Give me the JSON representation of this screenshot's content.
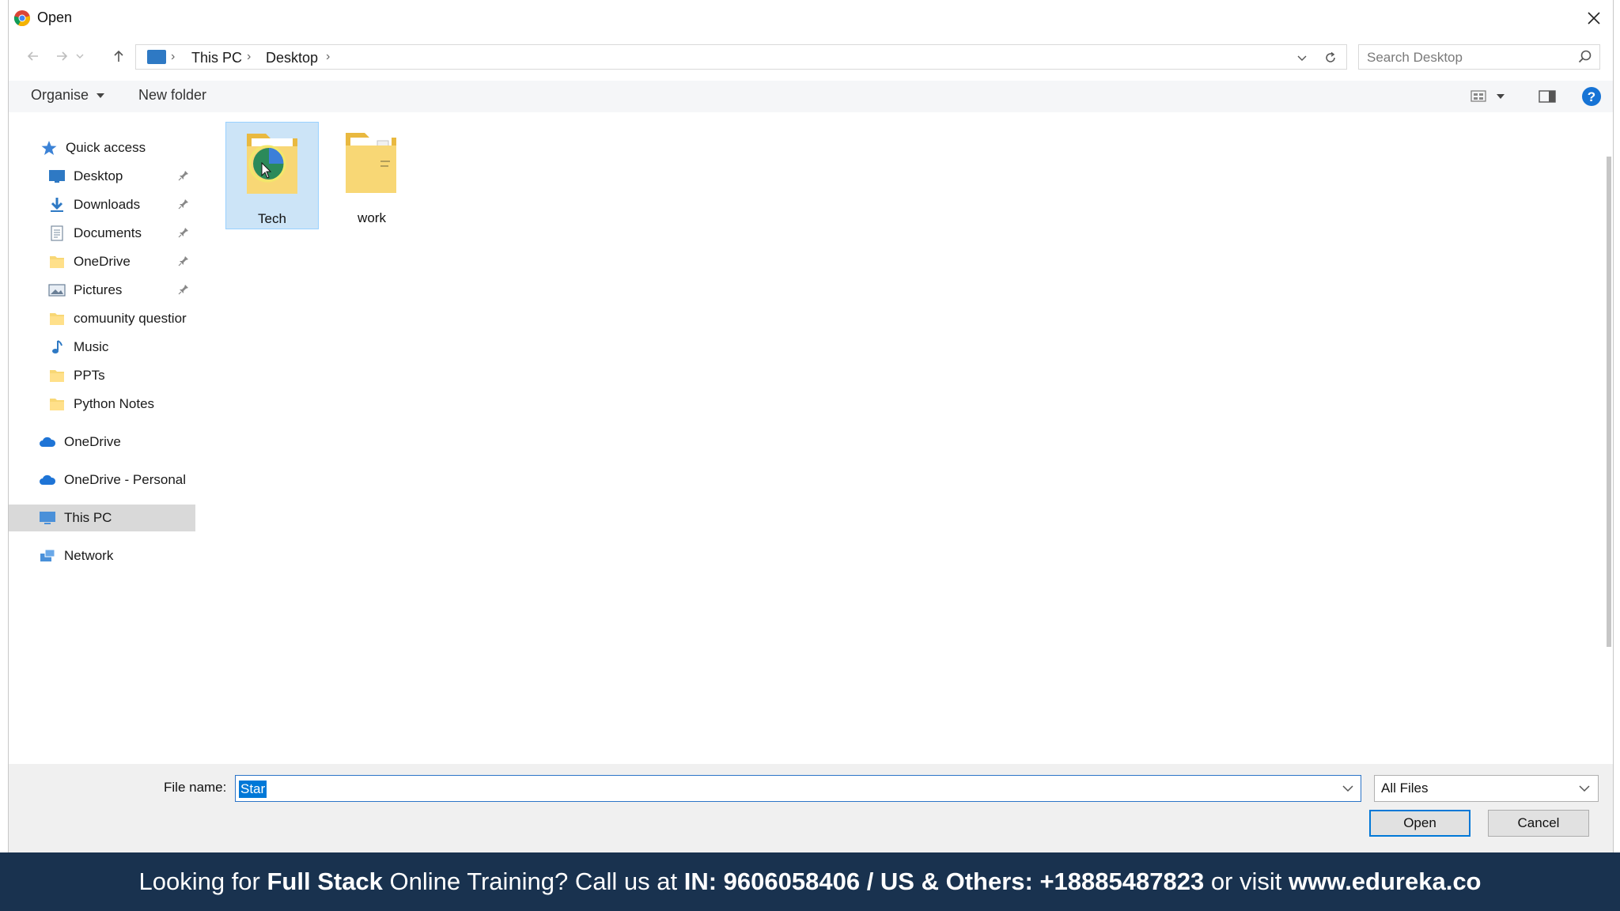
{
  "window": {
    "title": "Open",
    "close_label": "close"
  },
  "address": {
    "crumbs": [
      "This PC",
      "Desktop"
    ],
    "search_placeholder": "Search Desktop"
  },
  "toolbar": {
    "organise_label": "Organise",
    "new_folder_label": "New folder"
  },
  "navpane": {
    "quick_access": "Quick access",
    "quick_items": [
      {
        "label": "Desktop",
        "icon": "desktop-icon",
        "pinned": true
      },
      {
        "label": "Downloads",
        "icon": "download-icon",
        "pinned": true
      },
      {
        "label": "Documents",
        "icon": "documents-icon",
        "pinned": true
      },
      {
        "label": "OneDrive",
        "icon": "folder-icon",
        "pinned": true
      },
      {
        "label": "Pictures",
        "icon": "pictures-icon",
        "pinned": true
      },
      {
        "label": "comuunity questior",
        "icon": "folder-icon",
        "pinned": false
      },
      {
        "label": "Music",
        "icon": "music-icon",
        "pinned": false
      },
      {
        "label": "PPTs",
        "icon": "folder-icon",
        "pinned": false
      },
      {
        "label": "Python Notes",
        "icon": "folder-icon",
        "pinned": false
      }
    ],
    "onedrive": "OneDrive",
    "onedrive_personal": "OneDrive - Personal",
    "this_pc": "This PC",
    "network": "Network"
  },
  "files": [
    {
      "name": "Tech",
      "selected": true
    },
    {
      "name": "work",
      "selected": false
    }
  ],
  "bottom": {
    "file_name_label": "File name:",
    "file_name_value": "Star",
    "file_type": "All Files",
    "open_label": "Open",
    "cancel_label": "Cancel"
  },
  "banner": {
    "part1": "Looking for ",
    "part2": "Full Stack",
    "part3": " Online Training? Call us at ",
    "part4": "IN: 9606058406 / US & Others: +18885487823",
    "part5": " or visit ",
    "part6": "www.edureka.co"
  },
  "colors": {
    "accent": "#0078d7",
    "banner_bg": "#19324f",
    "selection": "#cce4f7"
  }
}
